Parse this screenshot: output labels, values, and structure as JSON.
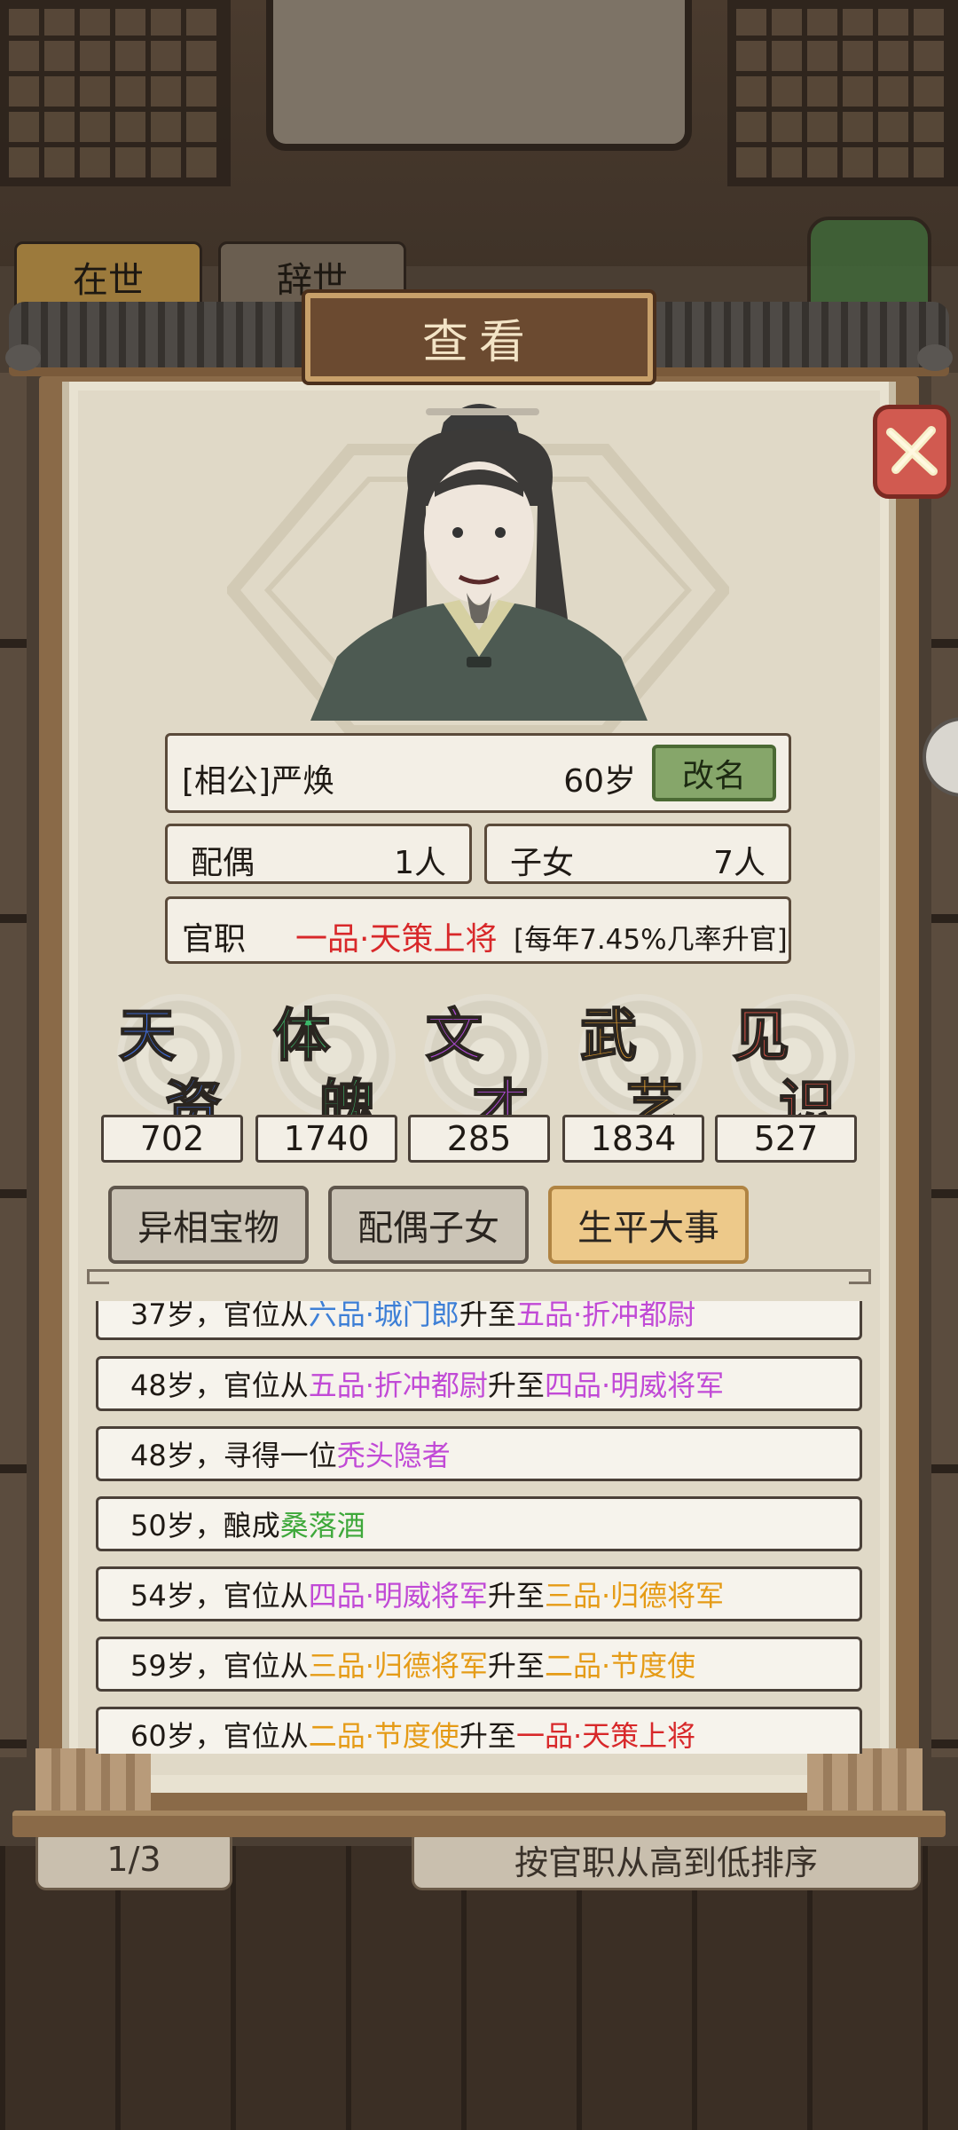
{
  "background": {
    "tabs": [
      "在世",
      "辞世"
    ],
    "pager": "1/3",
    "sort_label": "按官职从高到低排序"
  },
  "dialog": {
    "title": "查看",
    "close_icon": "close-x-icon"
  },
  "character": {
    "name": "[相公]严焕",
    "age": "60岁",
    "rename_label": "改名",
    "spouse_label": "配偶",
    "spouse_value": "1人",
    "children_label": "子女",
    "children_value": "7人",
    "rank_label": "官职",
    "rank_value": "一品·天策上将",
    "rank_note": "[每年7.45%几率升官]"
  },
  "stats": [
    {
      "chars": [
        "天",
        "资"
      ],
      "value": "702",
      "color": "#3f6fe0"
    },
    {
      "chars": [
        "体",
        "魄"
      ],
      "value": "1740",
      "color": "#3cb86a"
    },
    {
      "chars": [
        "文",
        "才"
      ],
      "value": "285",
      "color": "#b04ad8"
    },
    {
      "chars": [
        "武",
        "艺"
      ],
      "value": "1834",
      "color": "#e9a232"
    },
    {
      "chars": [
        "见",
        "识"
      ],
      "value": "527",
      "color": "#e2564a"
    }
  ],
  "tabs": [
    {
      "label": "异相宝物",
      "active": false
    },
    {
      "label": "配偶子女",
      "active": false
    },
    {
      "label": "生平大事",
      "active": true
    }
  ],
  "events": [
    [
      [
        "37岁，官位从",
        ""
      ],
      [
        "六品·城门郎",
        "c-blue"
      ],
      [
        "升至",
        ""
      ],
      [
        "五品·折冲都尉",
        "c-purple"
      ]
    ],
    [
      [
        "48岁，官位从",
        ""
      ],
      [
        "五品·折冲都尉",
        "c-purple"
      ],
      [
        "升至",
        ""
      ],
      [
        "四品·明威将军",
        "c-purple"
      ]
    ],
    [
      [
        "48岁，寻得一位",
        ""
      ],
      [
        "秃头隐者",
        "c-purple"
      ]
    ],
    [
      [
        "50岁，酿成",
        ""
      ],
      [
        "桑落酒",
        "c-green"
      ]
    ],
    [
      [
        "54岁，官位从",
        ""
      ],
      [
        "四品·明威将军",
        "c-purple"
      ],
      [
        "升至",
        ""
      ],
      [
        "三品·归德将军",
        "c-orange"
      ]
    ],
    [
      [
        "59岁，官位从",
        ""
      ],
      [
        "三品·归德将军",
        "c-orange"
      ],
      [
        "升至",
        ""
      ],
      [
        "二品·节度使",
        "c-orange"
      ]
    ],
    [
      [
        "60岁，官位从",
        ""
      ],
      [
        "二品·节度使",
        "c-orange"
      ],
      [
        "升至",
        ""
      ],
      [
        "一品·天策上将",
        "c-red"
      ]
    ]
  ]
}
